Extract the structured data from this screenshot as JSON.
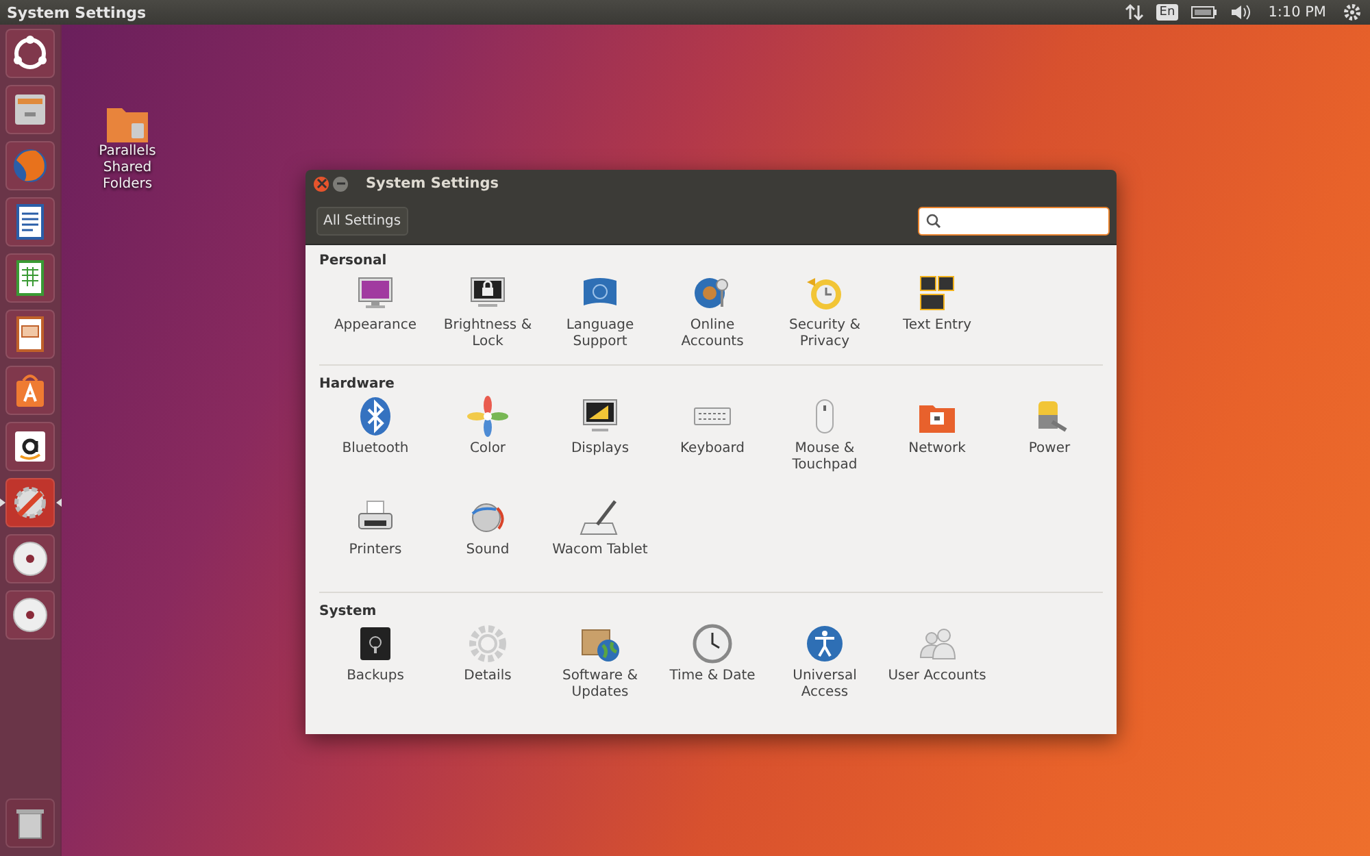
{
  "top_bar": {
    "title": "System Settings",
    "keyboard_layout": "En",
    "clock": "1:10 PM"
  },
  "launcher": {
    "items": [
      {
        "selected": false
      },
      {
        "selected": false
      },
      {
        "selected": false
      },
      {
        "selected": false
      },
      {
        "selected": false
      },
      {
        "selected": false
      },
      {
        "selected": false
      },
      {
        "selected": false
      },
      {
        "selected": true
      },
      {
        "selected": false
      },
      {
        "selected": false
      }
    ]
  },
  "desktop_icons": [
    {
      "label": "Parallels Shared Folders"
    }
  ],
  "window": {
    "title": "System Settings",
    "toolbar": {
      "all_settings_button": "All Settings"
    },
    "sections": [
      {
        "title": "Personal",
        "items": [
          {
            "label": "Appearance"
          },
          {
            "label": "Brightness & Lock"
          },
          {
            "label": "Language Support"
          },
          {
            "label": "Online Accounts"
          },
          {
            "label": "Security & Privacy"
          },
          {
            "label": "Text Entry"
          }
        ]
      },
      {
        "title": "Hardware",
        "items": [
          {
            "label": "Bluetooth"
          },
          {
            "label": "Color"
          },
          {
            "label": "Displays"
          },
          {
            "label": "Keyboard"
          },
          {
            "label": "Mouse & Touchpad"
          },
          {
            "label": "Network"
          },
          {
            "label": "Power"
          },
          {
            "label": "Printers"
          },
          {
            "label": "Sound"
          },
          {
            "label": "Wacom Tablet"
          }
        ]
      },
      {
        "title": "System",
        "items": [
          {
            "label": "Backups"
          },
          {
            "label": "Details"
          },
          {
            "label": "Software & Updates"
          },
          {
            "label": "Time & Date"
          },
          {
            "label": "Universal Access"
          },
          {
            "label": "User Accounts"
          }
        ]
      }
    ]
  }
}
